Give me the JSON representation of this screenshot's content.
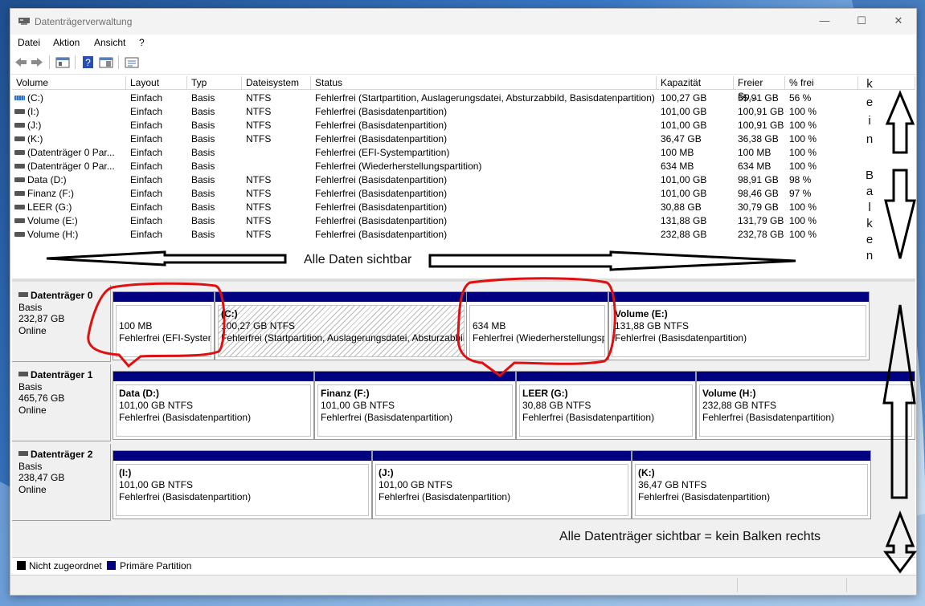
{
  "window": {
    "title": "Datenträgerverwaltung",
    "minimize": "—",
    "maximize": "☐",
    "close": "✕"
  },
  "menu": [
    "Datei",
    "Aktion",
    "Ansicht",
    "?"
  ],
  "columns": [
    "Volume",
    "Layout",
    "Typ",
    "Dateisystem",
    "Status",
    "Kapazität",
    "Freier Sp...",
    "% frei"
  ],
  "volumes": [
    {
      "icon": "system-volume-icon",
      "name": "(C:)",
      "layout": "Einfach",
      "typ": "Basis",
      "fs": "NTFS",
      "status": "Fehlerfrei (Startpartition, Auslagerungsdatei, Absturzabbild, Basisdatenpartition)",
      "kap": "100,27 GB",
      "frei": "55,91 GB",
      "pct": "56 %"
    },
    {
      "icon": "volume-icon",
      "name": "(I:)",
      "layout": "Einfach",
      "typ": "Basis",
      "fs": "NTFS",
      "status": "Fehlerfrei (Basisdatenpartition)",
      "kap": "101,00 GB",
      "frei": "100,91 GB",
      "pct": "100 %"
    },
    {
      "icon": "volume-icon",
      "name": "(J:)",
      "layout": "Einfach",
      "typ": "Basis",
      "fs": "NTFS",
      "status": "Fehlerfrei (Basisdatenpartition)",
      "kap": "101,00 GB",
      "frei": "100,91 GB",
      "pct": "100 %"
    },
    {
      "icon": "volume-icon",
      "name": "(K:)",
      "layout": "Einfach",
      "typ": "Basis",
      "fs": "NTFS",
      "status": "Fehlerfrei (Basisdatenpartition)",
      "kap": "36,47 GB",
      "frei": "36,38 GB",
      "pct": "100 %"
    },
    {
      "icon": "volume-icon",
      "name": "(Datenträger 0 Par...",
      "layout": "Einfach",
      "typ": "Basis",
      "fs": "",
      "status": "Fehlerfrei (EFI-Systempartition)",
      "kap": "100 MB",
      "frei": "100 MB",
      "pct": "100 %"
    },
    {
      "icon": "volume-icon",
      "name": "(Datenträger 0 Par...",
      "layout": "Einfach",
      "typ": "Basis",
      "fs": "",
      "status": "Fehlerfrei (Wiederherstellungspartition)",
      "kap": "634 MB",
      "frei": "634 MB",
      "pct": "100 %"
    },
    {
      "icon": "volume-icon",
      "name": "Data (D:)",
      "layout": "Einfach",
      "typ": "Basis",
      "fs": "NTFS",
      "status": "Fehlerfrei (Basisdatenpartition)",
      "kap": "101,00 GB",
      "frei": "98,91 GB",
      "pct": "98 %"
    },
    {
      "icon": "volume-icon",
      "name": "Finanz (F:)",
      "layout": "Einfach",
      "typ": "Basis",
      "fs": "NTFS",
      "status": "Fehlerfrei (Basisdatenpartition)",
      "kap": "101,00 GB",
      "frei": "98,46 GB",
      "pct": "97 %"
    },
    {
      "icon": "volume-icon",
      "name": "LEER (G:)",
      "layout": "Einfach",
      "typ": "Basis",
      "fs": "NTFS",
      "status": "Fehlerfrei (Basisdatenpartition)",
      "kap": "30,88 GB",
      "frei": "30,79 GB",
      "pct": "100 %"
    },
    {
      "icon": "volume-icon",
      "name": "Volume (E:)",
      "layout": "Einfach",
      "typ": "Basis",
      "fs": "NTFS",
      "status": "Fehlerfrei (Basisdatenpartition)",
      "kap": "131,88 GB",
      "frei": "131,79 GB",
      "pct": "100 %"
    },
    {
      "icon": "volume-icon",
      "name": "Volume (H:)",
      "layout": "Einfach",
      "typ": "Basis",
      "fs": "NTFS",
      "status": "Fehlerfrei (Basisdatenpartition)",
      "kap": "232,88 GB",
      "frei": "232,78 GB",
      "pct": "100 %"
    }
  ],
  "disks": [
    {
      "name": "Datenträger 0",
      "type": "Basis",
      "size": "232,87 GB",
      "state": "Online",
      "partitions": [
        {
          "name": "",
          "size": "100 MB",
          "status": "Fehlerfrei (EFI-Systempartition)",
          "hatch": false
        },
        {
          "name": "(C:)",
          "size": "100,27 GB NTFS",
          "status": "Fehlerfrei (Startpartition, Auslagerungsdatei, Absturzabbild, Basisdatenpartition)",
          "hatch": true
        },
        {
          "name": "",
          "size": "634 MB",
          "status": "Fehlerfrei (Wiederherstellungspartition)",
          "hatch": false
        },
        {
          "name": "Volume  (E:)",
          "size": "131,88 GB NTFS",
          "status": "Fehlerfrei (Basisdatenpartition)",
          "hatch": false
        }
      ]
    },
    {
      "name": "Datenträger 1",
      "type": "Basis",
      "size": "465,76 GB",
      "state": "Online",
      "partitions": [
        {
          "name": "Data  (D:)",
          "size": "101,00 GB NTFS",
          "status": "Fehlerfrei (Basisdatenpartition)",
          "hatch": false
        },
        {
          "name": "Finanz  (F:)",
          "size": "101,00 GB NTFS",
          "status": "Fehlerfrei (Basisdatenpartition)",
          "hatch": false
        },
        {
          "name": "LEER  (G:)",
          "size": "30,88 GB NTFS",
          "status": "Fehlerfrei (Basisdatenpartition)",
          "hatch": false
        },
        {
          "name": "Volume  (H:)",
          "size": "232,88 GB NTFS",
          "status": "Fehlerfrei (Basisdatenpartition)",
          "hatch": false
        }
      ]
    },
    {
      "name": "Datenträger 2",
      "type": "Basis",
      "size": "238,47 GB",
      "state": "Online",
      "partitions": [
        {
          "name": "(I:)",
          "size": "101,00 GB NTFS",
          "status": "Fehlerfrei (Basisdatenpartition)",
          "hatch": false
        },
        {
          "name": "(J:)",
          "size": "101,00 GB NTFS",
          "status": "Fehlerfrei (Basisdatenpartition)",
          "hatch": false
        },
        {
          "name": "(K:)",
          "size": "36,47 GB NTFS",
          "status": "Fehlerfrei (Basisdatenpartition)",
          "hatch": false
        }
      ]
    }
  ],
  "legend": {
    "unallocated": "Nicht zugeordnet",
    "primary": "Primäre Partition",
    "unallocated_color": "#000000",
    "primary_color": "#000080"
  },
  "annotations": {
    "top_text": "Alle Daten sichtbar",
    "bottom_text": "Alle Datenträger sichtbar = kein Balken rechts",
    "vertical_word1": [
      "k",
      "e",
      "i",
      "n"
    ],
    "vertical_word2": [
      "B",
      "a",
      "l",
      "k",
      "e",
      "n"
    ],
    "circle_color": "#e01010"
  }
}
